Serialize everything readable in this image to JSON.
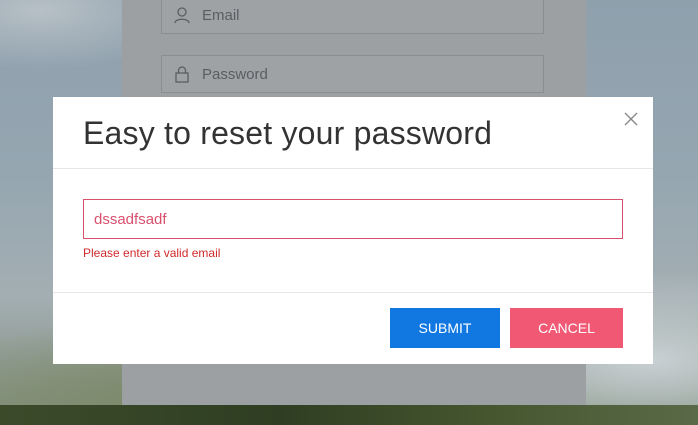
{
  "background": {
    "email_placeholder": "Email",
    "password_placeholder": "Password"
  },
  "modal": {
    "title": "Easy to reset your password",
    "close_icon": "close-icon",
    "email_value": "dssadfsadf",
    "error_message": "Please enter a valid email",
    "submit_label": "SUBMIT",
    "cancel_label": "CANCEL"
  },
  "colors": {
    "submit": "#1178e2",
    "cancel": "#f05874",
    "error": "#d12a2a",
    "invalid_border": "#d9506d"
  }
}
